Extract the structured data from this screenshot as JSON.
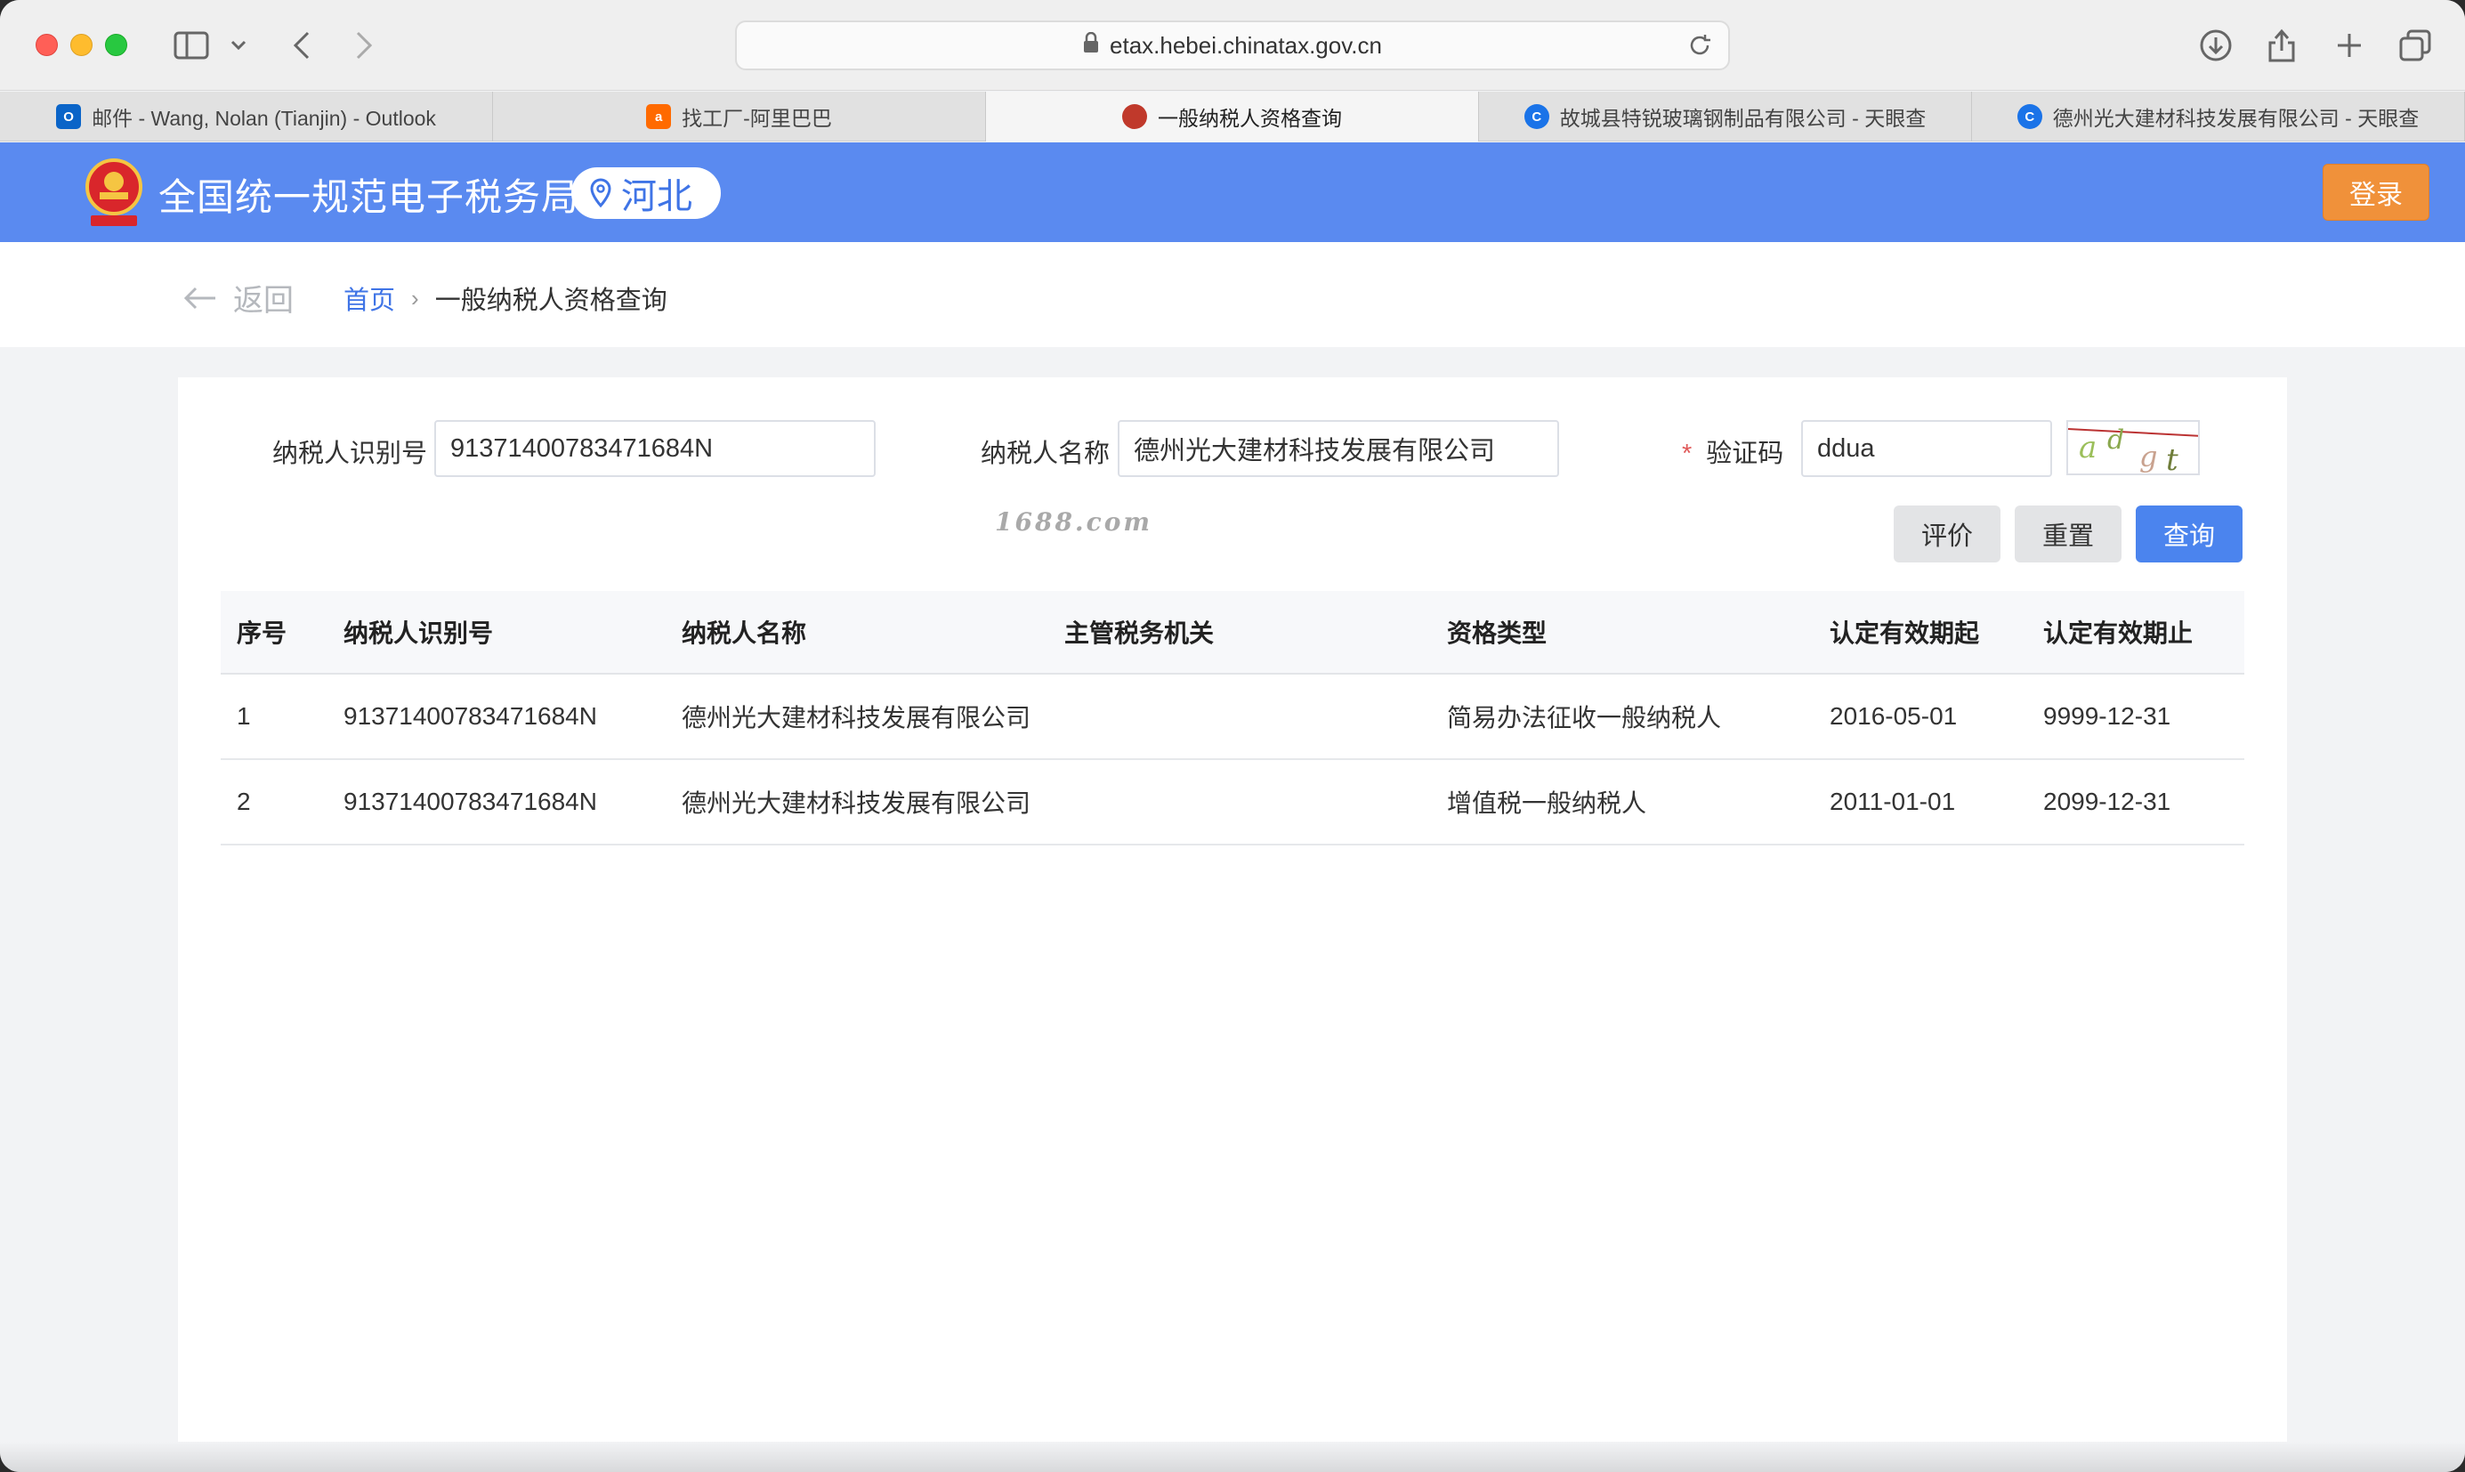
{
  "browser": {
    "url": "etax.hebei.chinatax.gov.cn",
    "tabs": [
      {
        "label": "邮件 - Wang, Nolan (Tianjin) - Outlook",
        "favicon_color": "#0a64c8",
        "active": false
      },
      {
        "label": "找工厂-阿里巴巴",
        "favicon_color": "#ff6a00",
        "active": false
      },
      {
        "label": "一般纳税人资格查询",
        "favicon_color": "#c0392b",
        "active": true
      },
      {
        "label": "故城县特锐玻璃钢制品有限公司 - 天眼查",
        "favicon_color": "#1a73e8",
        "active": false
      },
      {
        "label": "德州光大建材科技发展有限公司 - 天眼查",
        "favicon_color": "#1a73e8",
        "active": false
      }
    ]
  },
  "header": {
    "title": "全国统一规范电子税务局",
    "region": "河北",
    "login": "登录",
    "brand_color": "#5a8af0"
  },
  "breadcrumb": {
    "back": "返回",
    "home": "首页",
    "current": "一般纳税人资格查询"
  },
  "form": {
    "taxpayer_id_label": "纳税人识别号",
    "taxpayer_id_value": "91371400783471684N",
    "taxpayer_name_label": "纳税人名称",
    "taxpayer_name_value": "德州光大建材科技发展有限公司",
    "captcha_required_mark": "*",
    "captcha_label": "验证码",
    "captcha_value": "ddua",
    "captcha_image_text": "adgt",
    "buttons": {
      "evaluate": "评价",
      "reset": "重置",
      "query": "查询"
    }
  },
  "table": {
    "headers": [
      "序号",
      "纳税人识别号",
      "纳税人名称",
      "主管税务机关",
      "资格类型",
      "认定有效期起",
      "认定有效期止"
    ],
    "rows": [
      [
        "1",
        "91371400783471684N",
        "德州光大建材科技发展有限公司",
        "",
        "简易办法征收一般纳税人",
        "2016-05-01",
        "9999-12-31"
      ],
      [
        "2",
        "91371400783471684N",
        "德州光大建材科技发展有限公司",
        "",
        "增值税一般纳税人",
        "2011-01-01",
        "2099-12-31"
      ]
    ]
  },
  "watermark": "1688.com"
}
